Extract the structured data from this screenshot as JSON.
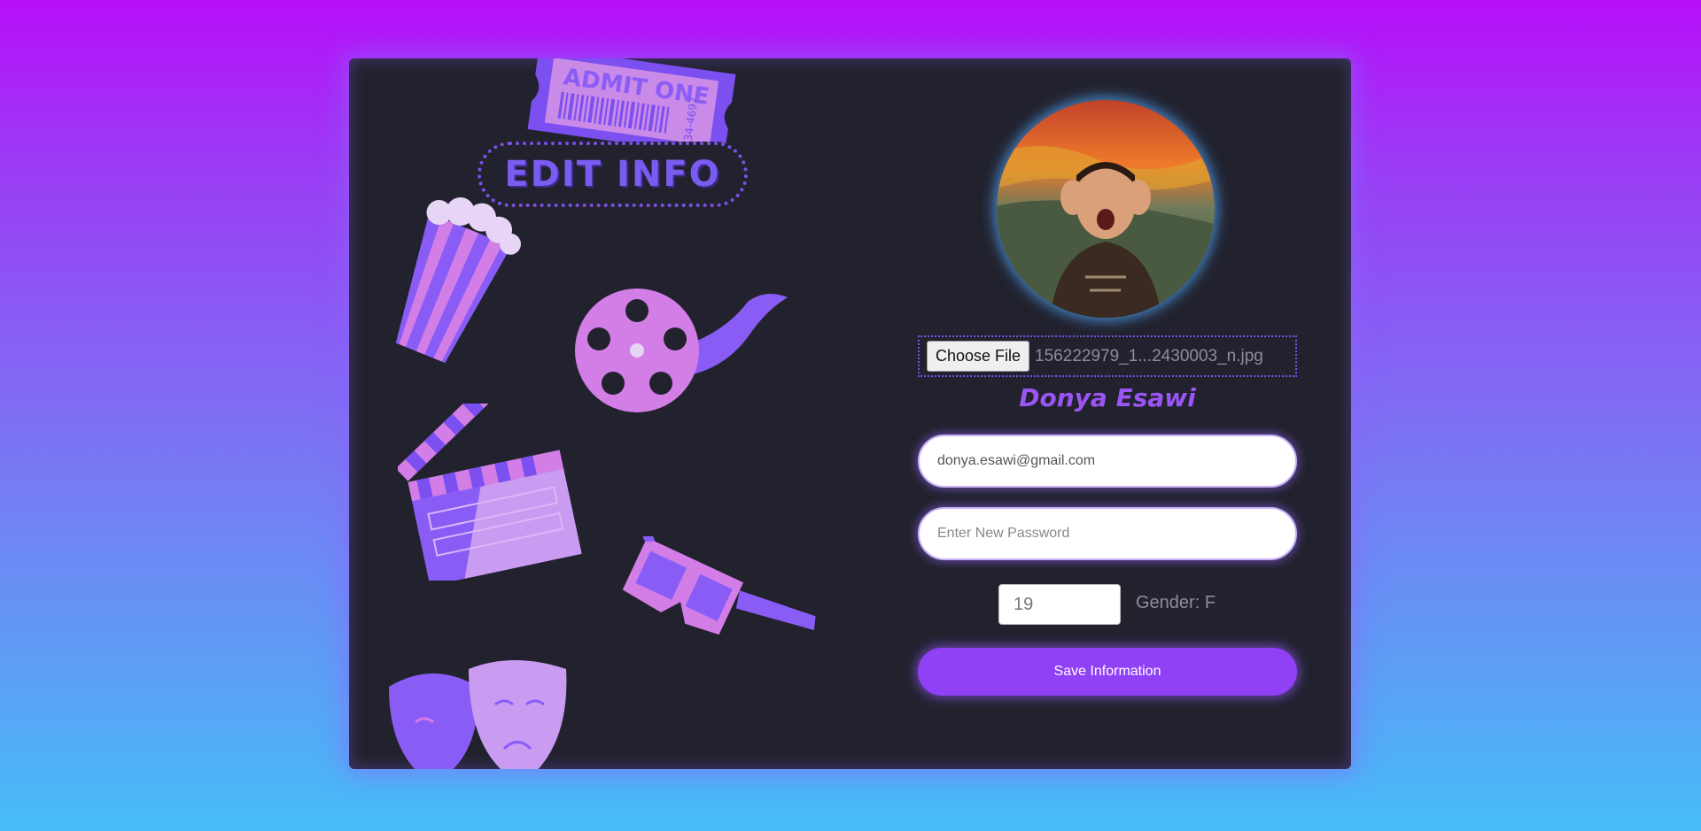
{
  "page": {
    "title": "EDIT INFO",
    "ticket_text": "ADMIT ONE",
    "ticket_number": "34-4697"
  },
  "profile": {
    "avatar_alt": "profile-photo",
    "file_button": "Choose File",
    "file_name": "156222979_1...2430003_n.jpg",
    "user_name": "Donya Esawi"
  },
  "form": {
    "email_value": "donya.esawi@gmail.com",
    "password_placeholder": "Enter New Password",
    "age_value": "19",
    "gender_label": "Gender: F",
    "save_label": "Save Information"
  },
  "colors": {
    "accent": "#9040f5",
    "card_bg": "#22222e",
    "deco_purple": "#8a5cf6",
    "deco_pink": "#d27ee6"
  }
}
